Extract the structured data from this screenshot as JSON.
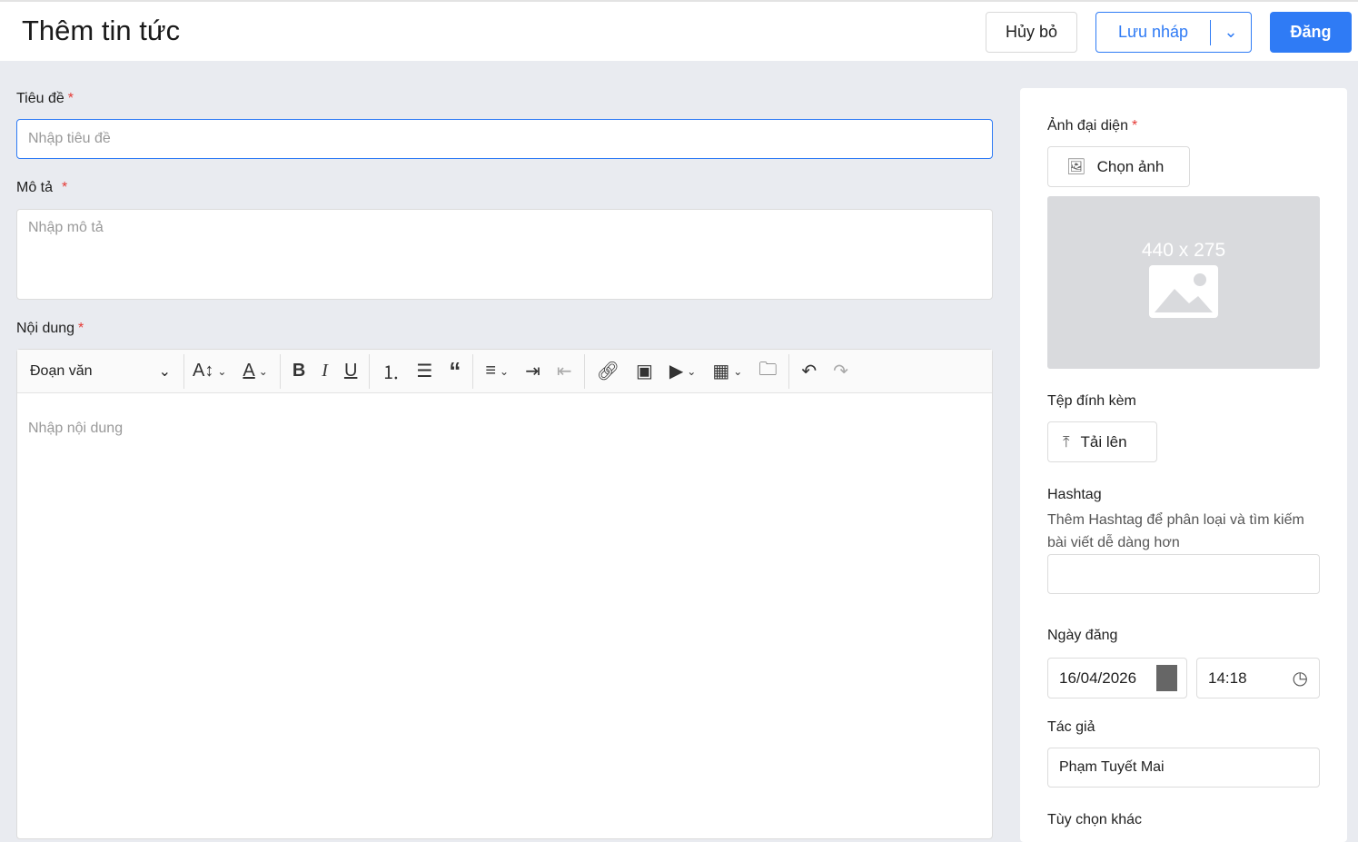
{
  "header": {
    "title": "Thêm tin tức",
    "cancel": "Hủy bỏ",
    "draft": "Lưu nháp",
    "publish": "Đăng"
  },
  "form": {
    "title_label": "Tiêu đề",
    "title_placeholder": "Nhập tiêu đề",
    "desc_label": "Mô tả",
    "desc_placeholder": "Nhập mô tả",
    "content_label": "Nội dung",
    "content_placeholder": "Nhập nội dung",
    "required_mark": "*",
    "paragraph_select": "Đoạn văn",
    "toolbar_icons": [
      "font-size-icon",
      "font-color-icon",
      "bold-icon",
      "italic-icon",
      "underline-icon",
      "numbered-list-icon",
      "bulleted-list-icon",
      "blockquote-icon",
      "align-icon",
      "indent-icon",
      "outdent-icon",
      "link-icon",
      "image-icon",
      "media-icon",
      "table-icon",
      "file-manager-icon",
      "undo-icon",
      "redo-icon"
    ]
  },
  "sidebar": {
    "thumb_label": "Ảnh đại diện",
    "choose_image": "Chọn ảnh",
    "placeholder_size": "440 x 275",
    "attach_label": "Tệp đính kèm",
    "upload": "Tải lên",
    "hashtag_label": "Hashtag",
    "hashtag_hint": "Thêm Hashtag để phân loại và tìm kiếm bài viết dễ dàng hơn",
    "date_label": "Ngày đăng",
    "date": "16/04/2026",
    "time": "14:18",
    "author_label": "Tác giả",
    "author": "Phạm Tuyết Mai",
    "other_label": "Tùy chọn khác"
  }
}
